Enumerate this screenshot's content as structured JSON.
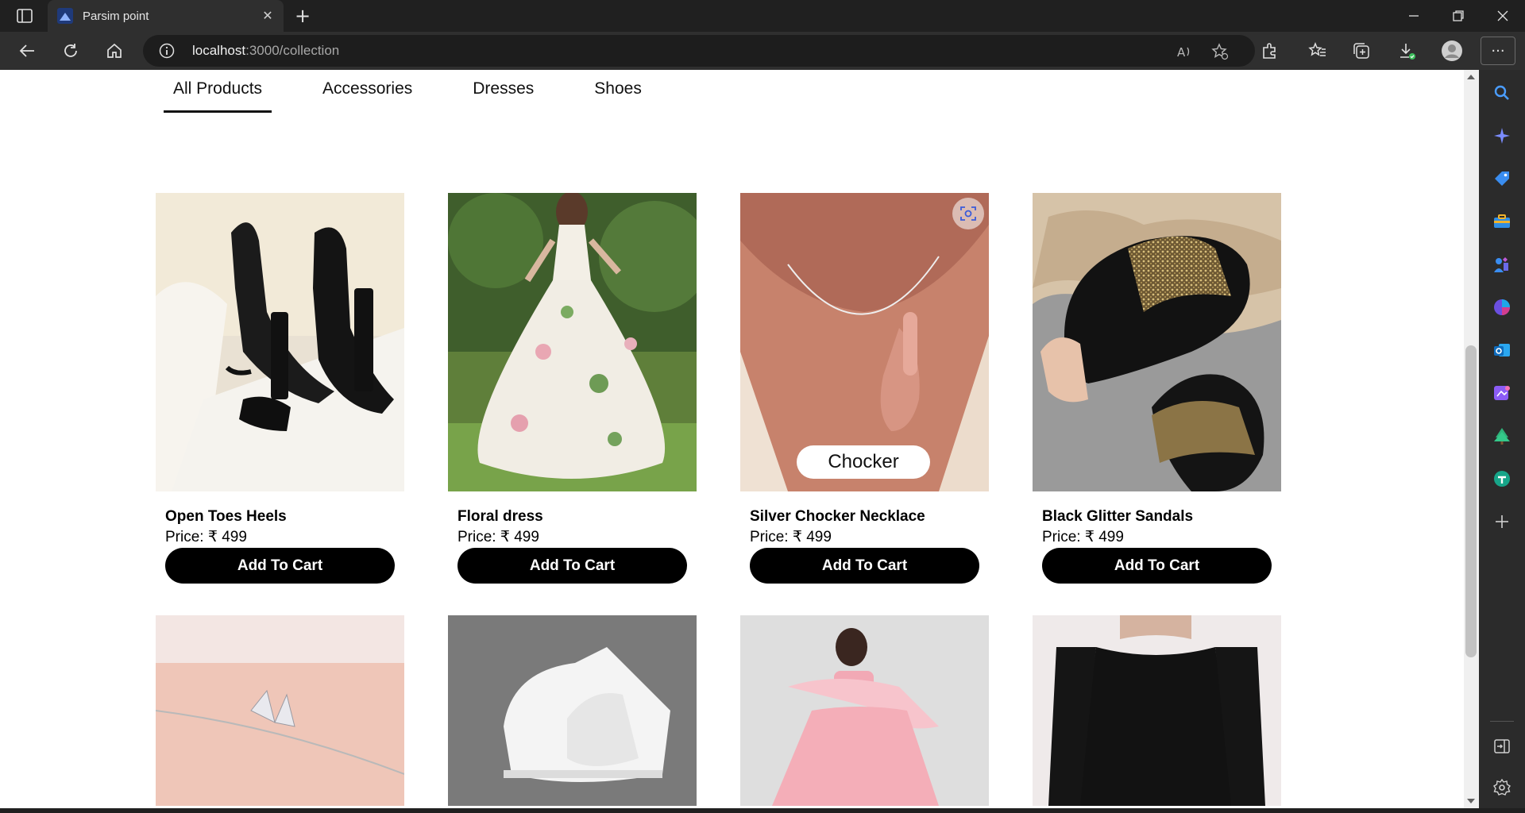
{
  "browser": {
    "tab_title": "Parsim point",
    "url_host": "localhost",
    "url_path": ":3000/collection",
    "icons": [
      "tab-actions-icon",
      "close-icon",
      "plus-icon",
      "minimize-icon",
      "restore-icon",
      "window-close-icon",
      "back-icon",
      "refresh-icon",
      "home-icon",
      "info-icon",
      "read-aloud-icon",
      "favorite-add-icon",
      "extensions-icon",
      "favorites-icon",
      "collections-icon",
      "downloads-icon",
      "profile-icon",
      "more-icon"
    ]
  },
  "sidebar": {
    "icons": [
      "search-icon",
      "copilot-icon",
      "shopping-tag-icon",
      "tools-icon",
      "games-icon",
      "microsoft-365-icon",
      "outlook-icon",
      "designer-icon",
      "tree-icon",
      "app-icon",
      "add-icon",
      "split-screen-icon",
      "settings-icon"
    ]
  },
  "categories": {
    "tabs": [
      "All Products",
      "Accessories",
      "Dresses",
      "Shoes"
    ],
    "active": "All Products"
  },
  "products": [
    {
      "name": "Open Toes Heels",
      "price": "Price: ₹ 499",
      "button": "Add To Cart"
    },
    {
      "name": "Floral dress",
      "price": "Price: ₹ 499",
      "button": "Add To Cart"
    },
    {
      "name": "Silver Chocker Necklace",
      "price": "Price: ₹ 499",
      "button": "Add To Cart",
      "tooltip": "Chocker"
    },
    {
      "name": "Black Glitter Sandals",
      "price": "Price: ₹ 499",
      "button": "Add To Cart"
    }
  ],
  "colors": {
    "chrome_bg": "#202020",
    "tab_bg": "#2f2f2f",
    "button_bg": "#000000",
    "page_bg": "#ffffff"
  }
}
